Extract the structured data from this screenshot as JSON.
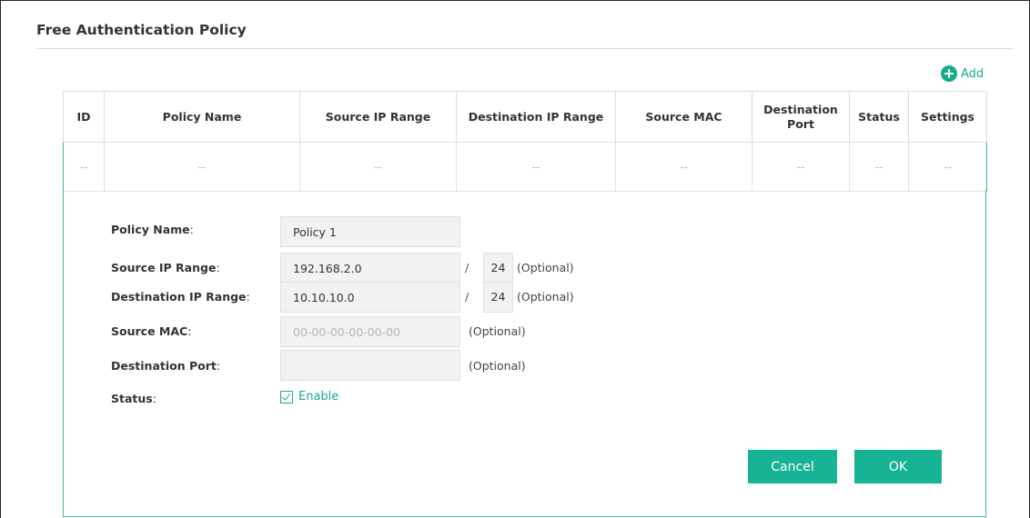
{
  "section": {
    "title": "Free Authentication Policy"
  },
  "toolbar": {
    "add_label": "Add"
  },
  "table": {
    "headers": [
      "ID",
      "Policy Name",
      "Source IP Range",
      "Destination IP Range",
      "Source MAC",
      "Destination Port",
      "Status",
      "Settings"
    ],
    "row": [
      "--",
      "--",
      "--",
      "--",
      "--",
      "--",
      "--",
      "--"
    ]
  },
  "form": {
    "policy_name": {
      "label": "Policy Name",
      "value": "Policy 1"
    },
    "source_ip": {
      "label": "Source IP Range",
      "value": "192.168.2.0",
      "mask": "24",
      "optional": "(Optional)"
    },
    "dest_ip": {
      "label": "Destination IP Range",
      "value": "10.10.10.0",
      "mask": "24",
      "optional": "(Optional)"
    },
    "source_mac": {
      "label": "Source MAC",
      "placeholder": "00-00-00-00-00-00",
      "optional": "(Optional)"
    },
    "dest_port": {
      "label": "Destination Port",
      "value": "",
      "optional": "(Optional)"
    },
    "status": {
      "label": "Status",
      "checkbox_label": "Enable",
      "checked": true
    },
    "slash": "/",
    "colon": ":"
  },
  "buttons": {
    "cancel": "Cancel",
    "ok": "OK"
  },
  "colors": {
    "accent": "#17a98c",
    "button": "#17b394",
    "panel_border": "#3cb99d"
  },
  "icons": {
    "add": "plus-circle-icon",
    "checkbox": "checkbox-checked-icon"
  }
}
